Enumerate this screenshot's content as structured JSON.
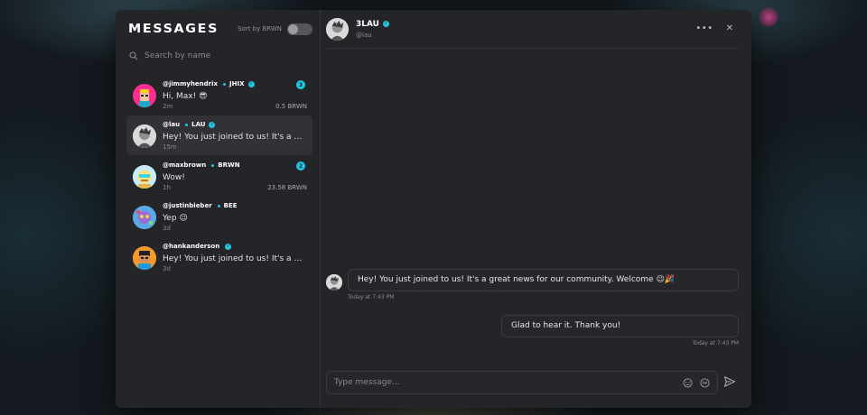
{
  "sidebar": {
    "title": "MESSAGES",
    "sort_label": "Sort by BRWN",
    "search_placeholder": "Search by name",
    "conversations": [
      {
        "handle": "@jimmyhendrix",
        "token": "JHIX",
        "preview": "Hi, Max! 😎",
        "time": "2m",
        "amount": "0.5 BRWN",
        "unread": "3"
      },
      {
        "handle": "@lau",
        "token": "LAU",
        "preview": "Hey! You just joined to us! It's a gre...",
        "time": "15m",
        "amount": "",
        "unread": ""
      },
      {
        "handle": "@maxbrown",
        "token": "BRWN",
        "preview": "Wow!",
        "time": "1h",
        "amount": "23.58 BRWN",
        "unread": "2"
      },
      {
        "handle": "@justinbieber",
        "token": "BEE",
        "preview": "Yep 😉",
        "time": "3d",
        "amount": "",
        "unread": ""
      },
      {
        "handle": "@hankanderson",
        "token": "",
        "preview": "Hey! You just joined to us! It's a gre...",
        "time": "3d",
        "amount": "",
        "unread": ""
      }
    ]
  },
  "chat": {
    "name": "3LAU",
    "handle": "@lau",
    "messages": [
      {
        "direction": "in",
        "text": "Hey! You just joined to us! It's a great news for our community. Welcome 😉🎉",
        "time": "Today at 7:43 PM"
      },
      {
        "direction": "out",
        "text": "Glad to hear it. Thank you!",
        "time": "Today at 7:43 PM"
      }
    ],
    "composer_placeholder": "Type message..."
  },
  "colors": {
    "accent": "#22c6e0",
    "panel": "#242528",
    "active_row": "#313236"
  }
}
